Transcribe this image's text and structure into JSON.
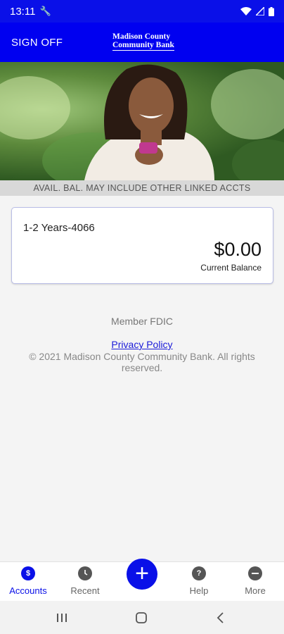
{
  "status_bar": {
    "time": "13:11"
  },
  "header": {
    "sign_off_label": "SIGN OFF",
    "logo_line1": "Madison County",
    "logo_line2": "Community Bank"
  },
  "notice": "AVAIL. BAL. MAY INCLUDE OTHER LINKED ACCTS",
  "account": {
    "name": "1-2 Years-4066",
    "balance": "$0.00",
    "balance_label": "Current Balance"
  },
  "footer": {
    "fdic": "Member FDIC",
    "privacy_link": "Privacy Policy",
    "copyright": "© 2021 Madison County Community Bank. All rights reserved."
  },
  "tabs": [
    {
      "label": "Accounts",
      "icon": "dollar-coin-icon",
      "active": true
    },
    {
      "label": "Recent",
      "icon": "clock-icon",
      "active": false
    },
    {
      "label": "Help",
      "icon": "question-icon",
      "active": false
    },
    {
      "label": "More",
      "icon": "more-icon",
      "active": false
    }
  ],
  "fab_label": "+",
  "colors": {
    "brand_blue": "#0000f0",
    "link_blue": "#1a1ad8"
  }
}
